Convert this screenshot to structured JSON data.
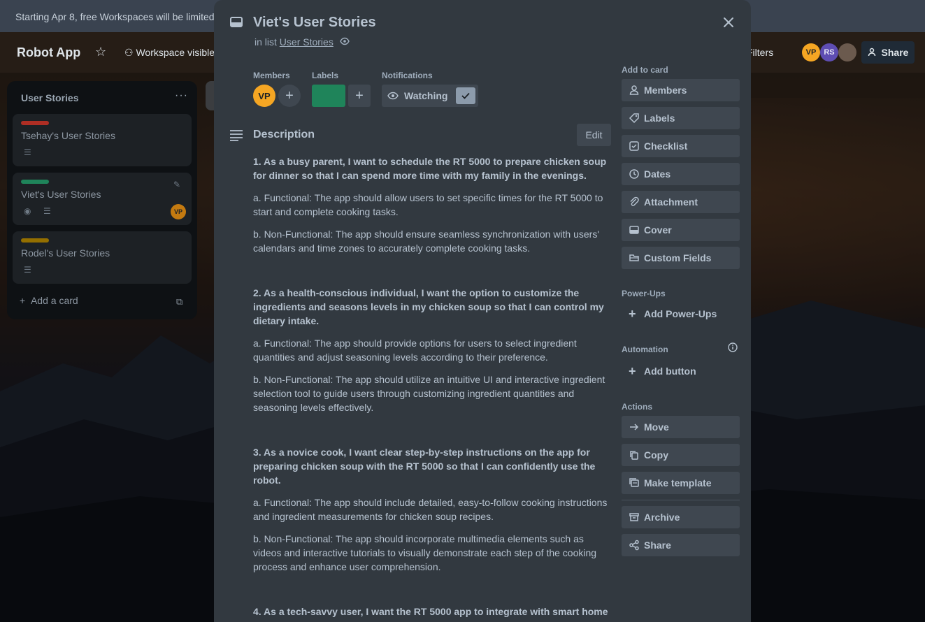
{
  "banner": {
    "text": "Starting Apr 8, free Workspaces will be limited"
  },
  "board": {
    "title": "Robot App",
    "workspace_visibility": "Workspace visible",
    "filters": "Filters",
    "members": [
      {
        "initials": "VP",
        "color": "#f5a623"
      },
      {
        "initials": "RS",
        "color": "#5e4db2"
      }
    ],
    "share": "Share"
  },
  "list": {
    "title": "User Stories",
    "menu": "···",
    "cards": [
      {
        "title": "Tsehay's User Stories",
        "label_color": "#ae2e24"
      },
      {
        "title": "Viet's User Stories",
        "label_color": "#1f845a",
        "avatar": "VP"
      },
      {
        "title": "Rodel's User Stories",
        "label_color": "#946f00"
      }
    ],
    "add_card": "Add a card"
  },
  "card": {
    "title": "Viet's User Stories",
    "in_list_prefix": "in list",
    "list_name": "User Stories",
    "members_label": "Members",
    "member_initials": "VP",
    "labels_label": "Labels",
    "label_color": "#1f845a",
    "notifications_label": "Notifications",
    "watching": "Watching",
    "description_title": "Description",
    "edit": "Edit",
    "description": [
      {
        "type": "story",
        "text": "1. As a busy parent, I want to schedule the RT 5000 to prepare chicken soup for dinner so that I can spend more time with my family in the evenings."
      },
      {
        "type": "req",
        "text": "a. Functional: The app should allow users to set specific times for the RT 5000 to start and complete cooking tasks."
      },
      {
        "type": "req",
        "text": "b. Non-Functional: The app should ensure seamless synchronization with users' calendars and time zones to accurately complete cooking tasks."
      },
      {
        "type": "story",
        "text": "2. As a health-conscious individual, I want the option to customize the ingredients and seasons levels in my chicken soup so that I can control my dietary intake."
      },
      {
        "type": "req",
        "text": "a. Functional: The app should provide options for users to select ingredient quantities and adjust seasoning levels according to their preference."
      },
      {
        "type": "req",
        "text": "b. Non-Functional: The app should utilize an intuitive UI and interactive ingredient selection tool to guide users through customizing ingredient quantities and seasoning levels effectively."
      },
      {
        "type": "story",
        "text": "3. As a novice cook, I want clear step-by-step instructions on the app for preparing chicken soup with the RT 5000 so that I can confidently use the robot."
      },
      {
        "type": "req",
        "text": "a. Functional: The app should include detailed, easy-to-follow cooking instructions and ingredient measurements for chicken soup recipes."
      },
      {
        "type": "req",
        "text": "b. Non-Functional: The app should incorporate multimedia elements such as videos and interactive tutorials to visually demonstrate each step of the cooking process and enhance user comprehension."
      },
      {
        "type": "story",
        "text": "4. As a tech-savvy user, I want the RT 5000 app to integrate with smart home"
      }
    ]
  },
  "sidebar": {
    "add_to_card": "Add to card",
    "add_items": [
      {
        "label": "Members",
        "icon": "person-icon"
      },
      {
        "label": "Labels",
        "icon": "tag-icon"
      },
      {
        "label": "Checklist",
        "icon": "checkbox-icon"
      },
      {
        "label": "Dates",
        "icon": "clock-icon"
      },
      {
        "label": "Attachment",
        "icon": "paperclip-icon"
      },
      {
        "label": "Cover",
        "icon": "cover-icon"
      },
      {
        "label": "Custom Fields",
        "icon": "field-icon"
      }
    ],
    "powerups_label": "Power-Ups",
    "add_powerups": "Add Power-Ups",
    "automation_label": "Automation",
    "add_button": "Add button",
    "actions_label": "Actions",
    "actions": [
      {
        "label": "Move",
        "icon": "arrow-right-icon"
      },
      {
        "label": "Copy",
        "icon": "copy-icon"
      },
      {
        "label": "Make template",
        "icon": "template-icon"
      },
      {
        "label": "Archive",
        "icon": "archive-icon"
      },
      {
        "label": "Share",
        "icon": "share-icon"
      }
    ]
  }
}
